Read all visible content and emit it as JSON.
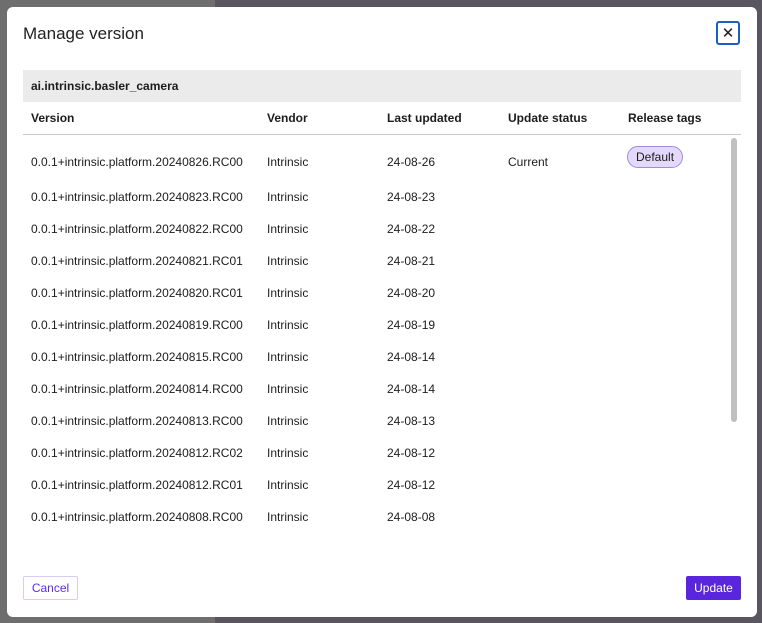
{
  "dialog": {
    "title": "Manage version",
    "close_icon": "close-icon"
  },
  "package": "ai.intrinsic.basler_camera",
  "columns": [
    "Version",
    "Vendor",
    "Last updated",
    "Update status",
    "Release tags"
  ],
  "rows": [
    {
      "version": "0.0.1+intrinsic.platform.20240826.RC00",
      "vendor": "Intrinsic",
      "updated": "24-08-26",
      "status": "Current",
      "tag": "Default"
    },
    {
      "version": "0.0.1+intrinsic.platform.20240823.RC00",
      "vendor": "Intrinsic",
      "updated": "24-08-23",
      "status": "",
      "tag": ""
    },
    {
      "version": "0.0.1+intrinsic.platform.20240822.RC00",
      "vendor": "Intrinsic",
      "updated": "24-08-22",
      "status": "",
      "tag": ""
    },
    {
      "version": "0.0.1+intrinsic.platform.20240821.RC01",
      "vendor": "Intrinsic",
      "updated": "24-08-21",
      "status": "",
      "tag": ""
    },
    {
      "version": "0.0.1+intrinsic.platform.20240820.RC01",
      "vendor": "Intrinsic",
      "updated": "24-08-20",
      "status": "",
      "tag": ""
    },
    {
      "version": "0.0.1+intrinsic.platform.20240819.RC00",
      "vendor": "Intrinsic",
      "updated": "24-08-19",
      "status": "",
      "tag": ""
    },
    {
      "version": "0.0.1+intrinsic.platform.20240815.RC00",
      "vendor": "Intrinsic",
      "updated": "24-08-14",
      "status": "",
      "tag": ""
    },
    {
      "version": "0.0.1+intrinsic.platform.20240814.RC00",
      "vendor": "Intrinsic",
      "updated": "24-08-14",
      "status": "",
      "tag": ""
    },
    {
      "version": "0.0.1+intrinsic.platform.20240813.RC00",
      "vendor": "Intrinsic",
      "updated": "24-08-13",
      "status": "",
      "tag": ""
    },
    {
      "version": "0.0.1+intrinsic.platform.20240812.RC02",
      "vendor": "Intrinsic",
      "updated": "24-08-12",
      "status": "",
      "tag": ""
    },
    {
      "version": "0.0.1+intrinsic.platform.20240812.RC01",
      "vendor": "Intrinsic",
      "updated": "24-08-12",
      "status": "",
      "tag": ""
    },
    {
      "version": "0.0.1+intrinsic.platform.20240808.RC00",
      "vendor": "Intrinsic",
      "updated": "24-08-08",
      "status": "",
      "tag": ""
    }
  ],
  "footer": {
    "cancel": "Cancel",
    "update": "Update"
  },
  "colors": {
    "accent": "#5a26dd",
    "badge_bg": "#e3d9fb",
    "focus": "#1a5fc4"
  }
}
